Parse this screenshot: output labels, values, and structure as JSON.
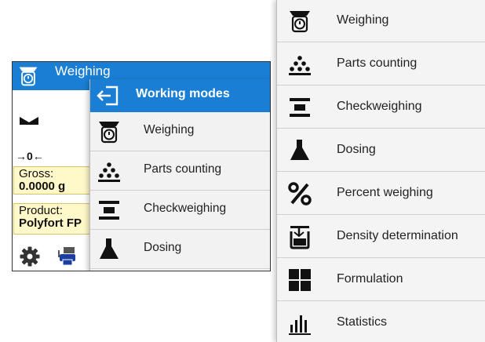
{
  "screen": {
    "header_title": "Weighing",
    "zero_indicator": "→0←",
    "gross_label": "Gross:",
    "gross_value": "0.0000 g",
    "product_label": "Product:",
    "product_value": "Polyfort FP"
  },
  "popup": {
    "title": "Working modes",
    "items": [
      {
        "label": "Weighing",
        "icon": "weighing-icon"
      },
      {
        "label": "Parts counting",
        "icon": "parts-counting-icon"
      },
      {
        "label": "Checkweighing",
        "icon": "checkweighing-icon"
      },
      {
        "label": "Dosing",
        "icon": "dosing-icon"
      }
    ]
  },
  "mode_list": {
    "items": [
      {
        "label": "Weighing",
        "icon": "weighing-icon"
      },
      {
        "label": "Parts counting",
        "icon": "parts-counting-icon"
      },
      {
        "label": "Checkweighing",
        "icon": "checkweighing-icon"
      },
      {
        "label": "Dosing",
        "icon": "dosing-icon"
      },
      {
        "label": "Percent weighing",
        "icon": "percent-icon"
      },
      {
        "label": "Density determination",
        "icon": "density-icon"
      },
      {
        "label": "Formulation",
        "icon": "formulation-icon"
      },
      {
        "label": "Statistics",
        "icon": "statistics-icon"
      }
    ]
  },
  "colors": {
    "header_blue": "#1a7fd4",
    "info_box_yellow": "#fff8c8",
    "icon_dark": "#111111"
  }
}
